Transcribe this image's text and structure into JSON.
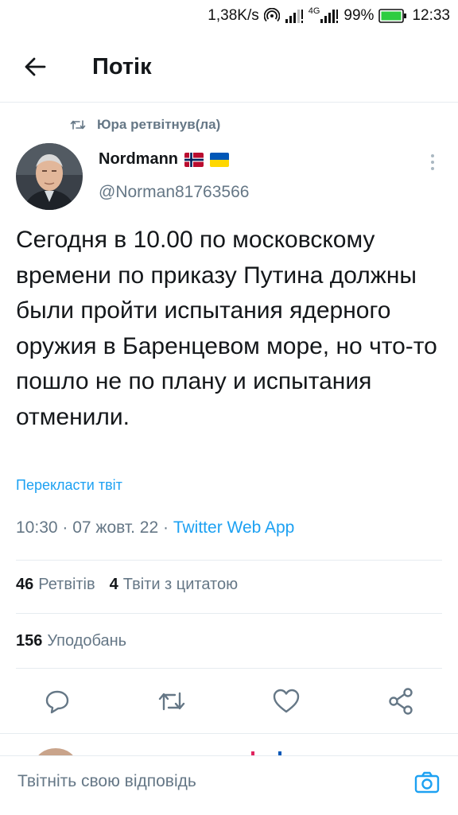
{
  "status_bar": {
    "speed": "1,38K/s",
    "network": "4G",
    "battery": "99%",
    "time": "12:33"
  },
  "header": {
    "title": "Потік"
  },
  "retweet_context": {
    "text": "Юра ретвітнув(ла)"
  },
  "author": {
    "name": "Nordmann",
    "handle": "@Norman81763566",
    "flags": [
      "flag-norway-icon",
      "flag-ukraine-icon"
    ]
  },
  "tweet": {
    "text": "Сегодня в 10.00 по московскому времени по приказу Путина должны были пройти испытания ядерного оружия в Баренцевом море, но что-то пошло не по плану и испытания отменили.",
    "translate_label": "Перекласти твіт",
    "time": "10:30",
    "date": "07 жовт. 22",
    "separator": " · ",
    "source": "Twitter Web App"
  },
  "stats": {
    "retweets_count": "46",
    "retweets_label": "Ретвітів",
    "quotes_count": "4",
    "quotes_label": "Твіти з цитатою",
    "likes_count": "156",
    "likes_label": "Уподобань"
  },
  "actions": [
    "reply-icon",
    "retweet-icon",
    "like-icon",
    "share-icon"
  ],
  "reply_bar": {
    "placeholder": "Твітніть свою відповідь"
  },
  "colors": {
    "accent": "#1da1f2",
    "secondary_text": "#657786",
    "primary_text": "#14171a",
    "divider": "#e6ecf0",
    "battery": "#2ecc40"
  }
}
